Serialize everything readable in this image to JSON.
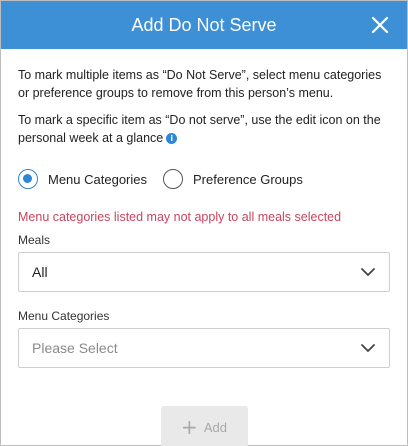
{
  "header": {
    "title": "Add Do Not Serve",
    "close_icon": "close-icon"
  },
  "body": {
    "paragraph1": "To mark multiple items as “Do Not Serve”, select menu categories or preference groups to remove from this person’s menu.",
    "paragraph2": "To mark a specific item as “Do not serve”, use the edit icon on the personal week at a glance",
    "info_icon_glyph": "i"
  },
  "radios": [
    {
      "label": "Menu Categories",
      "selected": true
    },
    {
      "label": "Preference Groups",
      "selected": false
    }
  ],
  "warning": "Menu categories listed may not apply to all meals selected",
  "meals": {
    "label": "Meals",
    "value": "All"
  },
  "menu_categories": {
    "label": "Menu Categories",
    "placeholder": "Please Select"
  },
  "add_button": {
    "label": "Add",
    "icon": "+",
    "disabled": true
  },
  "colors": {
    "header": "#3d8fd6",
    "accent": "#2f86d6",
    "warning": "#c9445f",
    "button_disabled": "#e9e9e9"
  }
}
